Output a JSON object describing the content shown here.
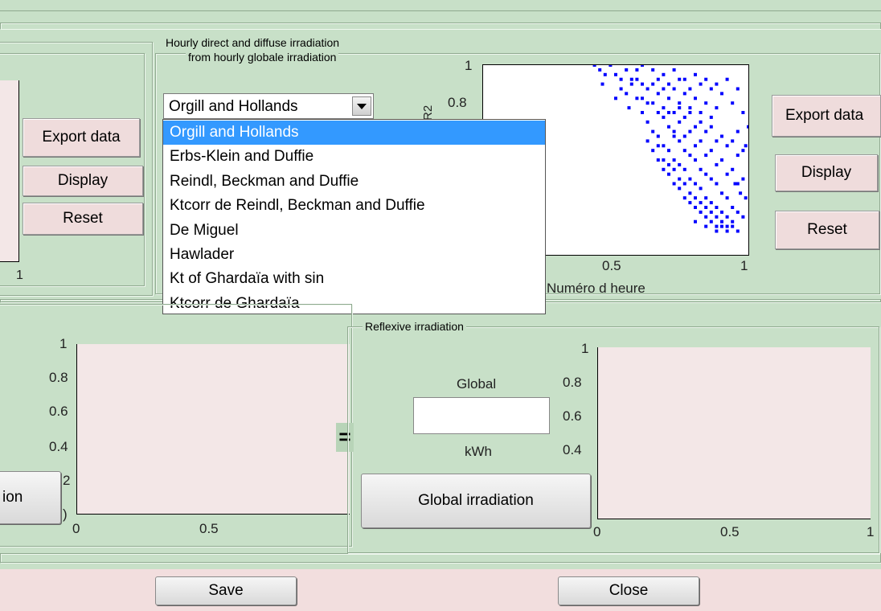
{
  "direct_diffuse_panel": {
    "title_line1": "Hourly direct and diffuse irradiation",
    "title_line2": "from hourly globale irradiation",
    "model_select_value": "Orgill and Hollands",
    "model_options": [
      "Orgill and Hollands",
      "Erbs-Klein and Duffie",
      "Reindl, Beckman and Duffie",
      "Ktcorr de Reindl, Beckman and Duffie",
      "De Miguel",
      "Hawlader",
      "Kt of Ghardaïa with sin",
      "Ktcorr de Ghardaïa"
    ],
    "export_label": "Export data",
    "display_label": "Display",
    "reset_label": "Reset"
  },
  "left_panel": {
    "export_label": "Export data",
    "display_label": "Display",
    "reset_label": "Reset",
    "axis_tick": "1"
  },
  "scatter": {
    "ylabel": "R2",
    "xlabel": "Numéro d heure",
    "yticks": [
      "1",
      "0.8"
    ],
    "xticks": [
      "0.5",
      "1"
    ]
  },
  "bottom_left": {
    "button_label": "ion",
    "yticks": [
      "1",
      "0.8",
      "0.6",
      "0.4",
      "2",
      ")"
    ],
    "xticks": [
      "0",
      "0.5"
    ]
  },
  "reflexive_panel": {
    "title": "Reflexive irradiation",
    "equals": "=",
    "global_label": "Global",
    "global_value": "",
    "unit": "kWh",
    "button_label": "Global irradiation",
    "yticks": [
      "1",
      "0.8",
      "0.6",
      "0.4"
    ],
    "xticks": [
      "0",
      "0.5",
      "1"
    ]
  },
  "footer": {
    "save_label": "Save",
    "close_label": "Close"
  },
  "chart_data": {
    "type": "scatter",
    "xlabel": "Numéro d heure",
    "ylabel": "R2",
    "xlim": [
      0,
      1
    ],
    "ylim": [
      0.6,
      1
    ],
    "color": "#0000ff",
    "series": [
      {
        "points": [
          [
            0.42,
            1.0
          ],
          [
            0.44,
            0.99
          ],
          [
            0.46,
            0.98
          ],
          [
            0.48,
            1.0
          ],
          [
            0.5,
            0.98
          ],
          [
            0.52,
            0.97
          ],
          [
            0.54,
            0.99
          ],
          [
            0.56,
            0.96
          ],
          [
            0.58,
            0.97
          ],
          [
            0.6,
            0.96
          ],
          [
            0.62,
            0.95
          ],
          [
            0.64,
            0.96
          ],
          [
            0.66,
            0.94
          ],
          [
            0.68,
            0.95
          ],
          [
            0.7,
            0.93
          ],
          [
            0.72,
            0.95
          ],
          [
            0.74,
            0.92
          ],
          [
            0.76,
            0.94
          ],
          [
            0.78,
            0.91
          ],
          [
            0.8,
            0.93
          ],
          [
            0.82,
            0.9
          ],
          [
            0.84,
            0.92
          ],
          [
            0.86,
            0.89
          ],
          [
            0.88,
            0.91
          ],
          [
            0.45,
            0.96
          ],
          [
            0.5,
            0.93
          ],
          [
            0.55,
            0.91
          ],
          [
            0.6,
            0.9
          ],
          [
            0.62,
            0.88
          ],
          [
            0.64,
            0.86
          ],
          [
            0.66,
            0.85
          ],
          [
            0.68,
            0.83
          ],
          [
            0.7,
            0.82
          ],
          [
            0.72,
            0.8
          ],
          [
            0.74,
            0.79
          ],
          [
            0.76,
            0.78
          ],
          [
            0.78,
            0.76
          ],
          [
            0.8,
            0.75
          ],
          [
            0.82,
            0.74
          ],
          [
            0.84,
            0.72
          ],
          [
            0.86,
            0.71
          ],
          [
            0.88,
            0.7
          ],
          [
            0.9,
            0.69
          ],
          [
            0.92,
            0.68
          ],
          [
            0.94,
            0.67
          ],
          [
            0.7,
            0.87
          ],
          [
            0.72,
            0.85
          ],
          [
            0.74,
            0.84
          ],
          [
            0.76,
            0.82
          ],
          [
            0.78,
            0.81
          ],
          [
            0.8,
            0.8
          ],
          [
            0.82,
            0.78
          ],
          [
            0.84,
            0.77
          ],
          [
            0.86,
            0.76
          ],
          [
            0.88,
            0.75
          ],
          [
            0.9,
            0.73
          ],
          [
            0.92,
            0.72
          ],
          [
            0.94,
            0.7
          ],
          [
            0.96,
            0.69
          ],
          [
            0.98,
            0.68
          ],
          [
            0.66,
            0.9
          ],
          [
            0.68,
            0.89
          ],
          [
            0.7,
            0.9
          ],
          [
            0.74,
            0.88
          ],
          [
            0.78,
            0.86
          ],
          [
            0.82,
            0.84
          ],
          [
            0.86,
            0.82
          ],
          [
            0.9,
            0.8
          ],
          [
            0.94,
            0.78
          ],
          [
            0.98,
            0.76
          ],
          [
            0.6,
            0.93
          ],
          [
            0.64,
            0.92
          ],
          [
            0.68,
            0.91
          ],
          [
            0.72,
            0.9
          ],
          [
            0.76,
            0.89
          ],
          [
            0.8,
            0.87
          ],
          [
            0.84,
            0.86
          ],
          [
            0.88,
            0.84
          ],
          [
            0.92,
            0.83
          ],
          [
            0.96,
            0.81
          ],
          [
            0.66,
            0.8
          ],
          [
            0.68,
            0.78
          ],
          [
            0.7,
            0.77
          ],
          [
            0.72,
            0.75
          ],
          [
            0.74,
            0.74
          ],
          [
            0.76,
            0.72
          ],
          [
            0.78,
            0.71
          ],
          [
            0.8,
            0.7
          ],
          [
            0.82,
            0.69
          ],
          [
            0.84,
            0.68
          ],
          [
            0.86,
            0.67
          ],
          [
            0.88,
            0.66
          ],
          [
            0.9,
            0.66
          ],
          [
            0.92,
            0.65
          ],
          [
            0.56,
            0.97
          ],
          [
            0.58,
            0.93
          ],
          [
            0.62,
            0.92
          ],
          [
            0.66,
            0.97
          ],
          [
            0.7,
            0.96
          ],
          [
            0.74,
            0.97
          ],
          [
            0.78,
            0.95
          ],
          [
            0.82,
            0.96
          ],
          [
            0.86,
            0.95
          ],
          [
            0.9,
            0.94
          ],
          [
            0.94,
            0.92
          ],
          [
            0.98,
            0.9
          ],
          [
            1.0,
            0.87
          ],
          [
            0.96,
            0.86
          ],
          [
            0.99,
            0.83
          ],
          [
            0.95,
            0.75
          ],
          [
            0.97,
            0.73
          ],
          [
            0.99,
            0.72
          ],
          [
            0.62,
            0.84
          ],
          [
            0.64,
            0.82
          ],
          [
            0.66,
            0.83
          ],
          [
            0.68,
            0.8
          ],
          [
            0.7,
            0.79
          ],
          [
            0.72,
            0.78
          ],
          [
            0.74,
            0.76
          ],
          [
            0.76,
            0.75
          ],
          [
            0.78,
            0.73
          ],
          [
            0.8,
            0.72
          ],
          [
            0.82,
            0.71
          ],
          [
            0.84,
            0.7
          ],
          [
            0.86,
            0.69
          ],
          [
            0.88,
            0.68
          ],
          [
            0.9,
            0.67
          ],
          [
            0.92,
            0.66
          ],
          [
            0.94,
            0.66
          ],
          [
            0.96,
            0.65
          ],
          [
            0.8,
            0.67
          ],
          [
            0.84,
            0.66
          ],
          [
            0.88,
            0.65
          ],
          [
            0.72,
            0.86
          ],
          [
            0.76,
            0.85
          ],
          [
            0.8,
            0.83
          ],
          [
            0.84,
            0.81
          ],
          [
            0.88,
            0.79
          ],
          [
            0.92,
            0.77
          ],
          [
            0.96,
            0.75
          ],
          [
            0.74,
            0.91
          ],
          [
            0.78,
            0.9
          ],
          [
            0.82,
            0.88
          ],
          [
            0.86,
            0.87
          ],
          [
            0.9,
            0.85
          ],
          [
            0.94,
            0.84
          ],
          [
            0.98,
            0.82
          ],
          [
            0.52,
            0.95
          ],
          [
            0.54,
            0.94
          ],
          [
            0.58,
            0.99
          ],
          [
            0.6,
            1.0
          ],
          [
            0.64,
            0.99
          ],
          [
            0.68,
            0.98
          ],
          [
            0.72,
            0.99
          ],
          [
            0.76,
            0.97
          ],
          [
            0.8,
            0.98
          ],
          [
            0.84,
            0.97
          ],
          [
            0.88,
            0.96
          ],
          [
            0.92,
            0.97
          ],
          [
            0.96,
            0.95
          ]
        ]
      }
    ]
  }
}
